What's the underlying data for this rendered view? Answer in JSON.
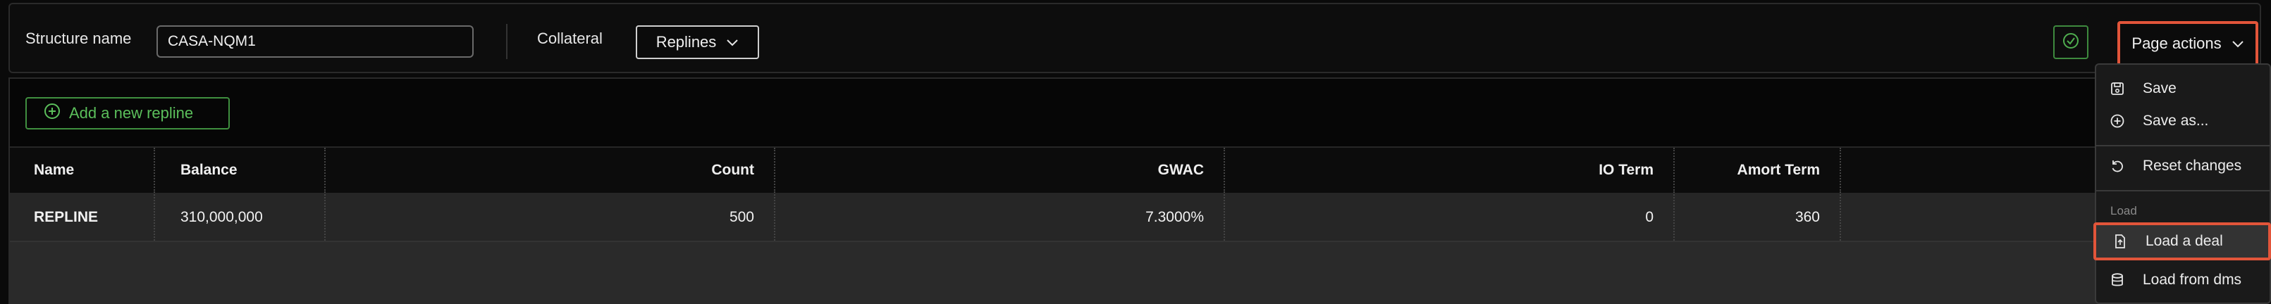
{
  "toolbar": {
    "structure_label": "Structure name",
    "structure_value": "CASA-NQM1",
    "collateral_label": "Collateral",
    "collateral_dropdown": "Replines",
    "page_actions_label": "Page actions"
  },
  "main": {
    "add_repline_label": "Add a new repline"
  },
  "table": {
    "headers": {
      "name": "Name",
      "balance": "Balance",
      "count": "Count",
      "gwac": "GWAC",
      "io_term": "IO Term",
      "amort_term": "Amort Term"
    },
    "rows": [
      {
        "name": "REPLINE",
        "balance": "310,000,000",
        "count": "500",
        "gwac": "7.3000%",
        "io_term": "0",
        "amort_term": "360"
      }
    ]
  },
  "menu": {
    "items": [
      {
        "label": "Save",
        "icon": "save-icon"
      },
      {
        "label": "Save as...",
        "icon": "plus-circle-icon"
      },
      {
        "label": "Reset changes",
        "icon": "undo-icon"
      }
    ],
    "group_label": "Load",
    "load_items": [
      {
        "label": "Load a deal",
        "icon": "file-upload-icon",
        "highlighted": true
      },
      {
        "label": "Load from dms",
        "icon": "database-icon"
      }
    ]
  },
  "colors": {
    "highlight": "#e2553a",
    "success": "#3e8a3e",
    "accent_green": "#5bbf5b"
  }
}
